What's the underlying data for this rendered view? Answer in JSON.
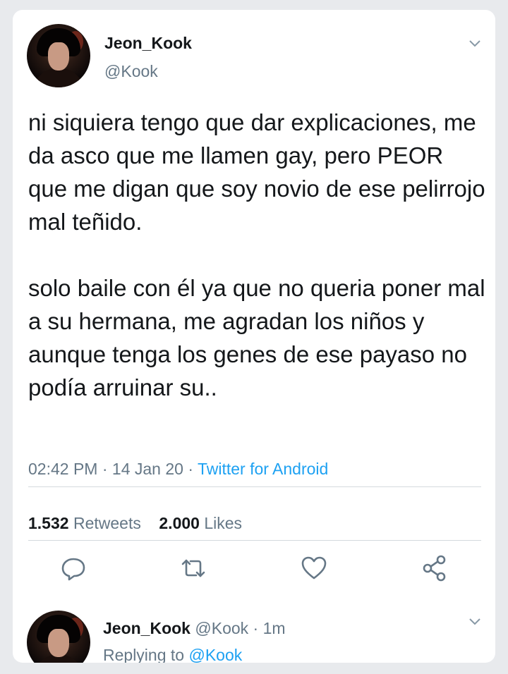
{
  "tweet": {
    "display_name": "Jeon_Kook",
    "handle": "@Kook",
    "paragraphs": [
      "ni siquiera tengo que dar explicaciones, me da asco que me llamen gay, pero PEOR que me digan que soy novio de ese pelirrojo mal teñido.",
      "solo baile con él ya que no queria poner mal a su hermana, me agradan los niños y aunque tenga los genes de ese payaso no podía arruinar su.."
    ],
    "time": "02:42 PM",
    "date": "14 Jan 20",
    "separator": " · ",
    "source": "Twitter for Android"
  },
  "stats": {
    "retweets_count": "1.532",
    "retweets_label": "Retweets",
    "likes_count": "2.000",
    "likes_label": "Likes"
  },
  "actions": [
    "reply-icon",
    "retweet-icon",
    "like-icon",
    "share-icon"
  ],
  "reply": {
    "display_name": "Jeon_Kook",
    "handle": "@Kook",
    "time": "1m",
    "replying_prefix": "Replying to",
    "replying_to": "@Kook"
  },
  "colors": {
    "accent": "#1da1f2",
    "secondary_text": "#657786",
    "primary_text": "#14171a",
    "background": "#e8eaed",
    "card": "#ffffff"
  }
}
